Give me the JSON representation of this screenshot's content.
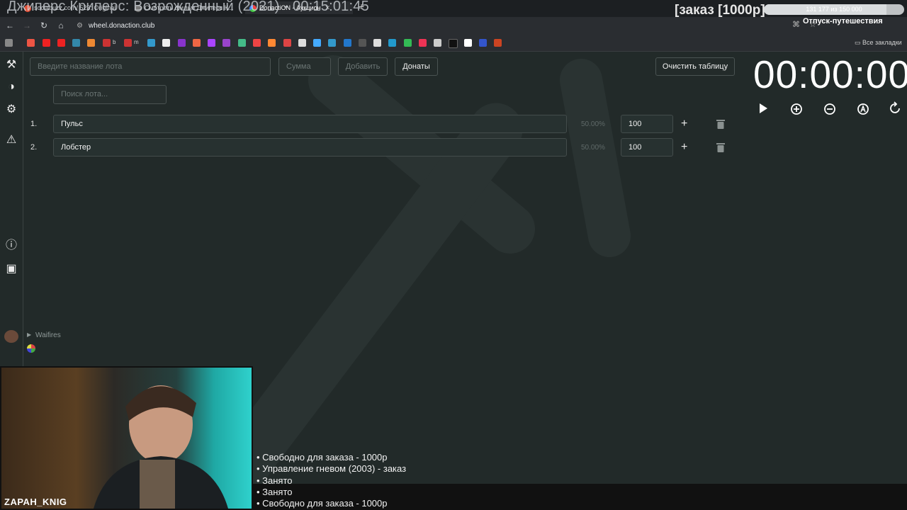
{
  "browser": {
    "tabs": [
      {
        "label": "sociabuzz.com/ 523: Original"
      },
      {
        "label": "Смотреть фильм Джиперс К..."
      },
      {
        "label": "DonactiON - Аукцион"
      }
    ],
    "url": "wheel.donaction.club",
    "all_bookmarks": "Все закладки",
    "bookmark_texts": [
      "b",
      "m"
    ]
  },
  "stream": {
    "title": "Джиперс Криперс: Возрожденный (2021) - 00:15:01:45",
    "order_title": "[заказ [1000р]",
    "progress_text": "131 177 из 150 000",
    "progress_fraction": 0.874,
    "vacation": "Отпуск-путешествия",
    "cam_name": "ZAPAH_KNIG",
    "orders": [
      "• Свободно для заказа - 1000р",
      "• Управление гневом (2003) - заказ",
      "• Занято",
      "• Занято",
      "• Свободно для заказа - 1000р"
    ]
  },
  "app": {
    "lot_placeholder": "Введите название лота",
    "amount_placeholder": "Сумма",
    "add_label": "Добавить",
    "donates_label": "Донаты",
    "clear_label": "Очистить таблицу",
    "search_placeholder": "Поиск лота...",
    "timer": "00:00:00",
    "user_name": "Waifires",
    "lots": [
      {
        "num": "1.",
        "name": "Пульс",
        "percent": "50.00%",
        "amount": "100"
      },
      {
        "num": "2.",
        "name": "Лобстер",
        "percent": "50.00%",
        "amount": "100"
      }
    ]
  },
  "colors": {
    "background": "#222a29",
    "chrome": "#2a2d31",
    "cam_teal": "#2fd1cc"
  }
}
